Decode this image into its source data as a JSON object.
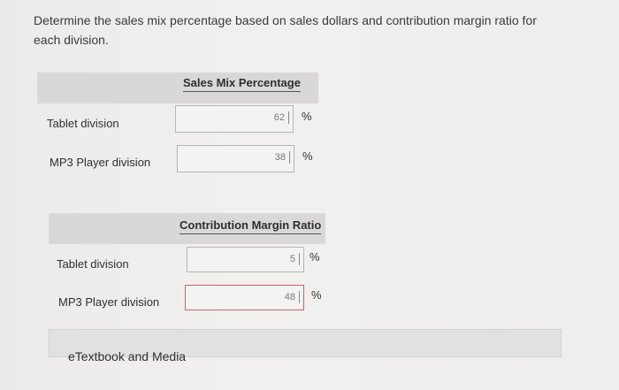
{
  "question": "Determine the sales mix percentage based on sales dollars and contribution margin ratio for each division.",
  "sales_mix": {
    "header": "Sales Mix Percentage",
    "rows": [
      {
        "label": "Tablet division",
        "value": "62",
        "unit": "%"
      },
      {
        "label": "MP3 Player division",
        "value": "38",
        "unit": "%"
      }
    ]
  },
  "cm_ratio": {
    "header": "Contribution Margin Ratio",
    "rows": [
      {
        "label": "Tablet division",
        "value": "5",
        "unit": "%"
      },
      {
        "label": "MP3 Player division",
        "value": "48",
        "unit": "%"
      }
    ]
  },
  "footer": {
    "etextbook_label": "eTextbook and Media"
  },
  "colors": {
    "error_border": "#c7636a",
    "band": "#d9d8d6"
  }
}
